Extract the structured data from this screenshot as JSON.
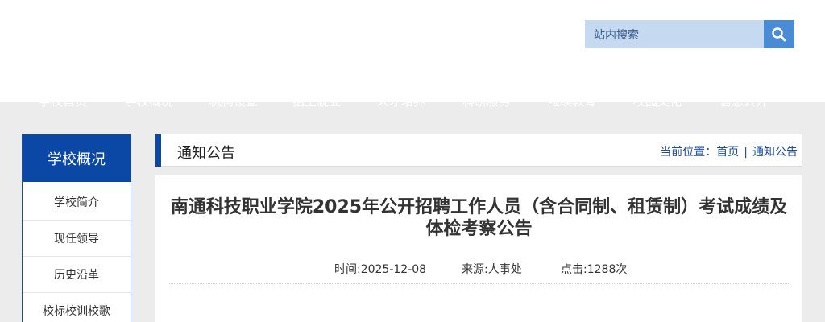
{
  "search": {
    "placeholder": "站内搜索"
  },
  "nav": {
    "items": [
      "学校首页",
      "学校概况",
      "机构设置",
      "招生就业",
      "人才培养",
      "科研服务",
      "继续教育",
      "校园文化",
      "信息公开"
    ]
  },
  "sidebar": {
    "title": "学校概况",
    "items": [
      "学校简介",
      "现任领导",
      "历史沿革",
      "校标校训校歌"
    ]
  },
  "content": {
    "section_title": "通知公告",
    "location_label": "当前位置：",
    "breadcrumb": [
      "首页",
      "通知公告"
    ]
  },
  "article": {
    "title": "南通科技职业学院2025年公开招聘工作人员（含合同制、租赁制）考试成绩及体检考察公告",
    "time": "时间:2025-12-08",
    "source": "来源:人事处",
    "clicks": "点击:1288次"
  },
  "colors": {
    "brand": "#0b47a4",
    "search_bg": "#c5d9f1",
    "search_btn": "#4a8bd6",
    "page_bg": "#ececec"
  }
}
